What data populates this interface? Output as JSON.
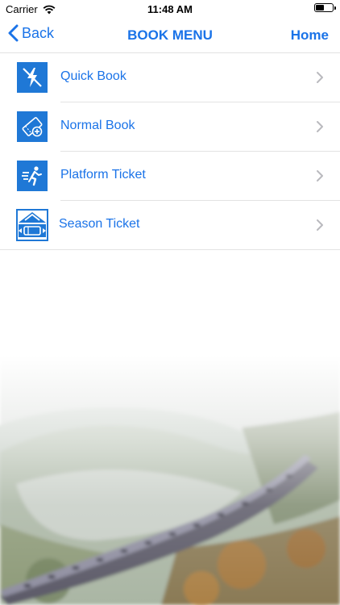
{
  "status": {
    "carrier": "Carrier",
    "time": "11:48 AM"
  },
  "nav": {
    "back_label": "Back",
    "title": "BOOK MENU",
    "home_label": "Home"
  },
  "menu": {
    "items": [
      {
        "label": "Quick Book",
        "icon": "lightning-icon"
      },
      {
        "label": "Normal Book",
        "icon": "ticket-add-icon"
      },
      {
        "label": "Platform Ticket",
        "icon": "running-person-icon"
      },
      {
        "label": "Season Ticket",
        "icon": "season-ticket-icon"
      }
    ]
  },
  "colors": {
    "accent": "#1a73e8",
    "icon_bg": "#1f78d6"
  }
}
